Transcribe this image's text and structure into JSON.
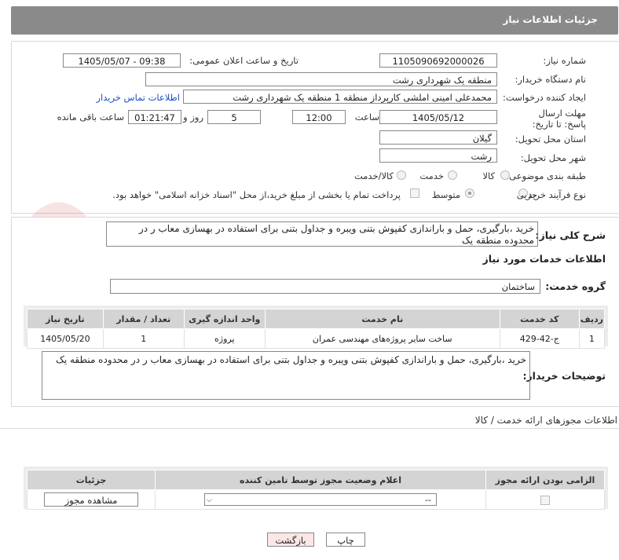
{
  "header": {
    "title": "جزئیات اطلاعات نیاز"
  },
  "form": {
    "need_number_label": "شماره نیاز:",
    "need_number": "1105090692000026",
    "announce_label": "تاریخ و ساعت اعلان عمومی:",
    "announce_value": "1405/05/07 - 09:38",
    "buyer_org_label": "نام دستگاه خریدار:",
    "buyer_org": "منطقه یک شهرداری رشت",
    "creator_label": "ایجاد کننده درخواست:",
    "creator": "محمدعلی امینی املشی کارپرداز منطقه 1 منطقه یک شهرداری رشت",
    "contact_link": "اطلاعات تماس خریدار",
    "deadline_label": "مهلت ارسال پاسخ: تا تاریخ:",
    "deadline_date": "1405/05/12",
    "time_label": "ساعت",
    "deadline_time": "12:00",
    "days_value": "5",
    "days_label": "روز و",
    "remaining_value": "01:21:47",
    "remaining_label": "ساعت باقی مانده",
    "province_label": "استان محل تحویل:",
    "province": "گیلان",
    "city_label": "شهر محل تحویل:",
    "city": "رشت",
    "category_label": "طبقه بندی موضوعی:",
    "category_options": [
      "کالا",
      "خدمت",
      "کالا/خدمت"
    ],
    "process_label": "نوع فرآیند خرید :",
    "process_options": [
      "جزیی",
      "متوسط"
    ],
    "payment_note": "پرداخت تمام یا بخشی از مبلغ خرید،از محل \"اسناد خزانه اسلامی\" خواهد بود."
  },
  "details": {
    "summary_label": "شرح کلی نیاز:",
    "summary": "خرید ،بارگیری، حمل و باراندازی کفپوش بتنی ویبره و جداول بتنی برای استفاده در بهسازی معاب ر در محدوده منطقه یک",
    "services_title": "اطلاعات خدمات مورد نیاز",
    "service_group_label": "گروه خدمت:",
    "service_group": "ساختمان",
    "table_headers": [
      "ردیف",
      "کد خدمت",
      "نام خدمت",
      "واحد اندازه گیری",
      "تعداد / مقدار",
      "تاریخ نیاز"
    ],
    "table_rows": [
      [
        "1",
        "ج-42-429",
        "ساخت سایر پروژه‌های مهندسی عمران",
        "پروژه",
        "1",
        "1405/05/20"
      ]
    ],
    "buyer_desc_label": "توضیحات خریدار:",
    "buyer_desc": "خرید ،بارگیری، حمل و باراندازی کفپوش بتنی ویبره و جداول بتنی برای استفاده در بهسازی معاب ر در محدوده منطقه یک"
  },
  "permits": {
    "title": "اطلاعات مجوزهای ارائه خدمت / کالا",
    "headers": [
      "الزامی بودن ارائه مجوز",
      "اعلام وضعیت مجوز توسط تامین کننده",
      "جزئیات"
    ],
    "select_value": "--",
    "view_button": "مشاهده مجوز"
  },
  "watermark_text": "AriaTender.net",
  "buttons": {
    "print": "چاپ",
    "back": "بازگشت"
  }
}
